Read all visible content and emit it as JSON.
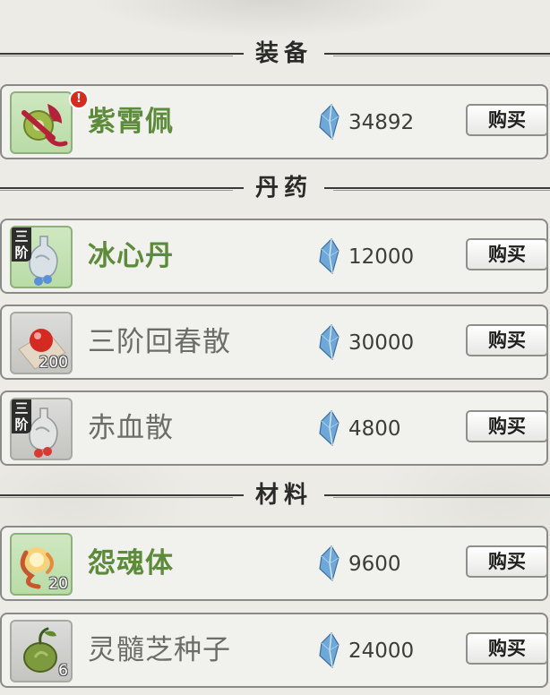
{
  "sections": {
    "equipment": {
      "title": "装备"
    },
    "pills": {
      "title": "丹药"
    },
    "materials": {
      "title": "材料"
    }
  },
  "items": [
    {
      "name": "紫霄佩",
      "price": "34892",
      "icon": "jade-pendant-icon",
      "rank": "",
      "qty": "",
      "alert": "!",
      "available": true,
      "buy_label": "购买"
    },
    {
      "name": "冰心丹",
      "price": "12000",
      "icon": "pill-gourd-icon",
      "rank": "三阶",
      "qty": "",
      "available": true,
      "buy_label": "购买"
    },
    {
      "name": "三阶回春散",
      "price": "30000",
      "icon": "red-pill-icon",
      "rank": "",
      "qty": "200",
      "available": false,
      "buy_label": "购买"
    },
    {
      "name": "赤血散",
      "price": "4800",
      "icon": "pill-gourd-icon",
      "rank": "三阶",
      "qty": "",
      "available": false,
      "buy_label": "购买"
    },
    {
      "name": "怨魂体",
      "price": "9600",
      "icon": "spirit-flame-icon",
      "rank": "",
      "qty": "20",
      "available": true,
      "buy_label": "购买"
    },
    {
      "name": "灵髓芝种子",
      "price": "24000",
      "icon": "seed-icon",
      "rank": "",
      "qty": "6",
      "available": false,
      "buy_label": "购买"
    }
  ],
  "currency_icon": "spirit-crystal-icon",
  "colors": {
    "available_name": "#5c8b3a",
    "unavailable_name": "#6c6c69",
    "alert": "#d72b1e"
  }
}
